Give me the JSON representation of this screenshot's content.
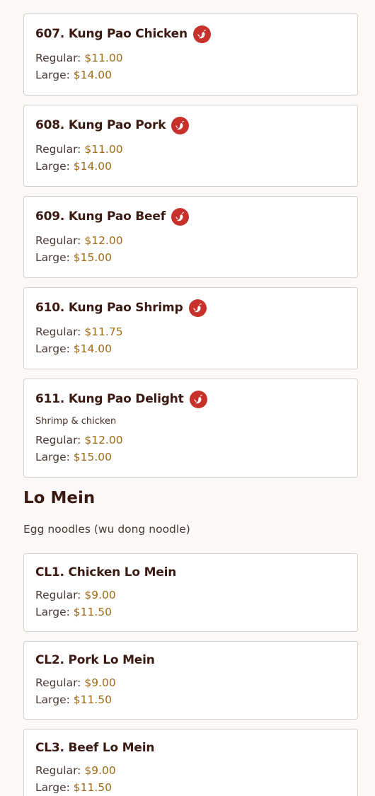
{
  "kung_pao_items": [
    {
      "name": "607. Kung Pao Chicken",
      "spicy": true,
      "description": "",
      "regular_label": "Regular:",
      "regular_price": "$11.00",
      "large_label": "Large:",
      "large_price": "$14.00"
    },
    {
      "name": "608. Kung Pao Pork",
      "spicy": true,
      "description": "",
      "regular_label": "Regular:",
      "regular_price": "$11.00",
      "large_label": "Large:",
      "large_price": "$14.00"
    },
    {
      "name": "609. Kung Pao Beef",
      "spicy": true,
      "description": "",
      "regular_label": "Regular:",
      "regular_price": "$12.00",
      "large_label": "Large:",
      "large_price": "$15.00"
    },
    {
      "name": "610. Kung Pao Shrimp",
      "spicy": true,
      "description": "",
      "regular_label": "Regular:",
      "regular_price": "$11.75",
      "large_label": "Large:",
      "large_price": "$14.00"
    },
    {
      "name": "611. Kung Pao Delight",
      "spicy": true,
      "description": "Shrimp & chicken",
      "regular_label": "Regular:",
      "regular_price": "$12.00",
      "large_label": "Large:",
      "large_price": "$15.00"
    }
  ],
  "lo_mein_section": {
    "title": "Lo Mein",
    "description": "Egg noodles (wu dong noodle)",
    "items": [
      {
        "name": "CL1. Chicken Lo Mein",
        "regular_label": "Regular:",
        "regular_price": "$9.00",
        "large_label": "Large:",
        "large_price": "$11.50"
      },
      {
        "name": "CL2. Pork Lo Mein",
        "regular_label": "Regular:",
        "regular_price": "$9.00",
        "large_label": "Large:",
        "large_price": "$11.50"
      },
      {
        "name": "CL3. Beef Lo Mein",
        "regular_label": "Regular:",
        "regular_price": "$9.00",
        "large_label": "Large:",
        "large_price": "$11.50"
      }
    ]
  },
  "icons": {
    "spicy": "chili-pepper-icon"
  },
  "colors": {
    "spicy_badge": "#c8302c",
    "price": "#a06a18",
    "title": "#3a1a12",
    "background": "#faf9f7",
    "border": "#d4d0cc"
  }
}
